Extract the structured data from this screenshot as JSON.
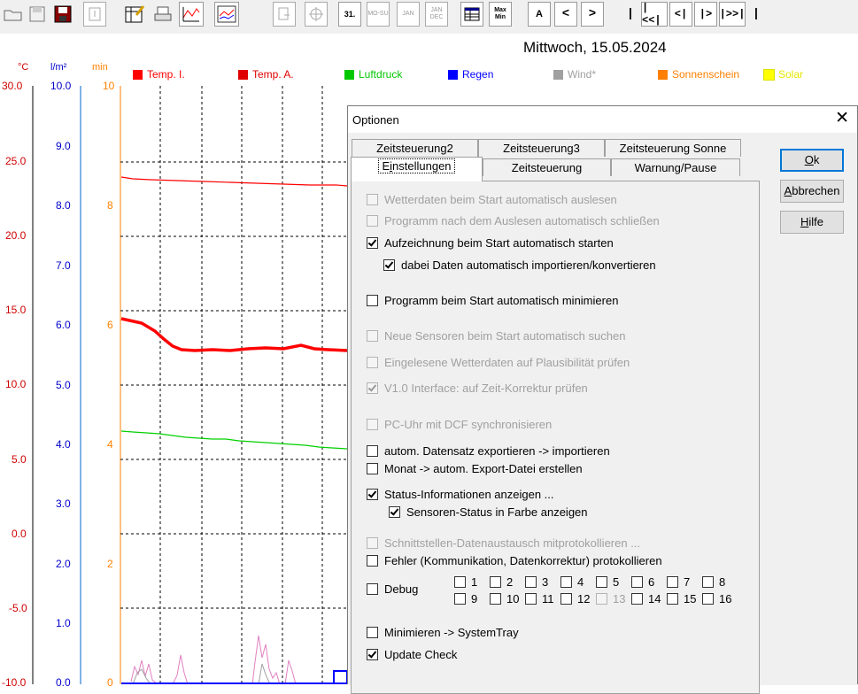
{
  "toolbar": {
    "calendar_badge": "31.",
    "week_label": "MO-SU",
    "jan_label": "JAN",
    "jan_dec_label": "JAN DEC",
    "max_min_label": "Max Min",
    "font_label": "A",
    "nav_prev": "<",
    "nav_next": ">",
    "nav_first": "|<<|",
    "nav_back": "<|",
    "nav_fwd": "|>",
    "nav_last": "|>>|"
  },
  "chart": {
    "date_title": "Mittwoch, 15.05.2024",
    "unit_temp": "°C",
    "unit_rain": "l/m²",
    "unit_min": "min",
    "temp_ticks": [
      "30.0",
      "25.0",
      "20.0",
      "15.0",
      "10.0",
      "5.0",
      "0.0",
      "-5.0",
      "-10.0"
    ],
    "rain_ticks": [
      "10.0",
      "9.0",
      "8.0",
      "7.0",
      "6.0",
      "5.0",
      "4.0",
      "3.0",
      "2.0",
      "1.0",
      "0.0"
    ],
    "min_ticks": [
      "10",
      "8",
      "6",
      "4",
      "2",
      "0"
    ],
    "legend": [
      {
        "label": "Temp. I.",
        "color": "#ff0000"
      },
      {
        "label": "Temp. A.",
        "color": "#e00000"
      },
      {
        "label": "Luftdruck",
        "color": "#00c800"
      },
      {
        "label": "Regen",
        "color": "#0000ff"
      },
      {
        "label": "Wind*",
        "color": "#a0a0a0"
      },
      {
        "label": "Sonnenschein",
        "color": "#ff8000"
      },
      {
        "label": "Solar",
        "color": "#ffff00"
      }
    ]
  },
  "dialog": {
    "title": "Optionen",
    "close_glyph": "✕",
    "tabs_row1": [
      "Zeitsteuerung2",
      "Zeitsteuerung3",
      "Zeitsteuerung Sonne"
    ],
    "tabs_row2": [
      "Einstellungen",
      "Zeitsteuerung",
      "Warnung/Pause"
    ],
    "active_tab": "Einstellungen",
    "buttons": {
      "ok": "Ok",
      "cancel": "Abbrechen",
      "help": "Hilfe"
    },
    "options": [
      {
        "label": "Wetterdaten beim Start automatisch auslesen",
        "checked": false,
        "disabled": true
      },
      {
        "label": "Programm nach dem Auslesen automatisch schließen",
        "checked": false,
        "disabled": true
      },
      {
        "label": "Aufzeichnung beim Start automatisch starten",
        "checked": true,
        "disabled": false
      },
      {
        "label": "dabei Daten automatisch importieren/konvertieren",
        "checked": true,
        "disabled": false
      },
      {
        "label": "Programm beim Start automatisch minimieren",
        "checked": false,
        "disabled": false
      },
      {
        "label": "Neue Sensoren beim Start automatisch suchen",
        "checked": false,
        "disabled": true
      },
      {
        "label": "Eingelesene Wetterdaten auf Plausibilität prüfen",
        "checked": false,
        "disabled": true
      },
      {
        "label": "V1.0 Interface: auf Zeit-Korrektur prüfen",
        "checked": true,
        "disabled": true
      },
      {
        "label": "PC-Uhr mit DCF synchronisieren",
        "checked": false,
        "disabled": true
      },
      {
        "label": "autom. Datensatz exportieren -> importieren",
        "checked": false,
        "disabled": false
      },
      {
        "label": "Monat -> autom. Export-Datei erstellen",
        "checked": false,
        "disabled": false
      },
      {
        "label": "Status-Informationen anzeigen ...",
        "checked": true,
        "disabled": false
      },
      {
        "label": "Sensoren-Status in Farbe anzeigen",
        "checked": true,
        "disabled": false
      },
      {
        "label": "Schnittstellen-Datenaustausch mitprotokollieren ...",
        "checked": false,
        "disabled": true
      },
      {
        "label": "Fehler (Kommunikation, Datenkorrektur) protokollieren",
        "checked": false,
        "disabled": false
      },
      {
        "label": "Minimieren -> SystemTray",
        "checked": false,
        "disabled": false
      },
      {
        "label": "Update Check",
        "checked": true,
        "disabled": false
      }
    ],
    "debug_label": "Debug",
    "debug_levels": [
      {
        "label": "1",
        "disabled": false
      },
      {
        "label": "2",
        "disabled": false
      },
      {
        "label": "3",
        "disabled": false
      },
      {
        "label": "4",
        "disabled": false
      },
      {
        "label": "5",
        "disabled": false
      },
      {
        "label": "6",
        "disabled": false
      },
      {
        "label": "7",
        "disabled": false
      },
      {
        "label": "8",
        "disabled": false
      },
      {
        "label": "9",
        "disabled": false
      },
      {
        "label": "10",
        "disabled": false
      },
      {
        "label": "11",
        "disabled": false
      },
      {
        "label": "12",
        "disabled": false
      },
      {
        "label": "13",
        "disabled": true
      },
      {
        "label": "14",
        "disabled": false
      },
      {
        "label": "15",
        "disabled": false
      },
      {
        "label": "16",
        "disabled": false
      }
    ]
  }
}
